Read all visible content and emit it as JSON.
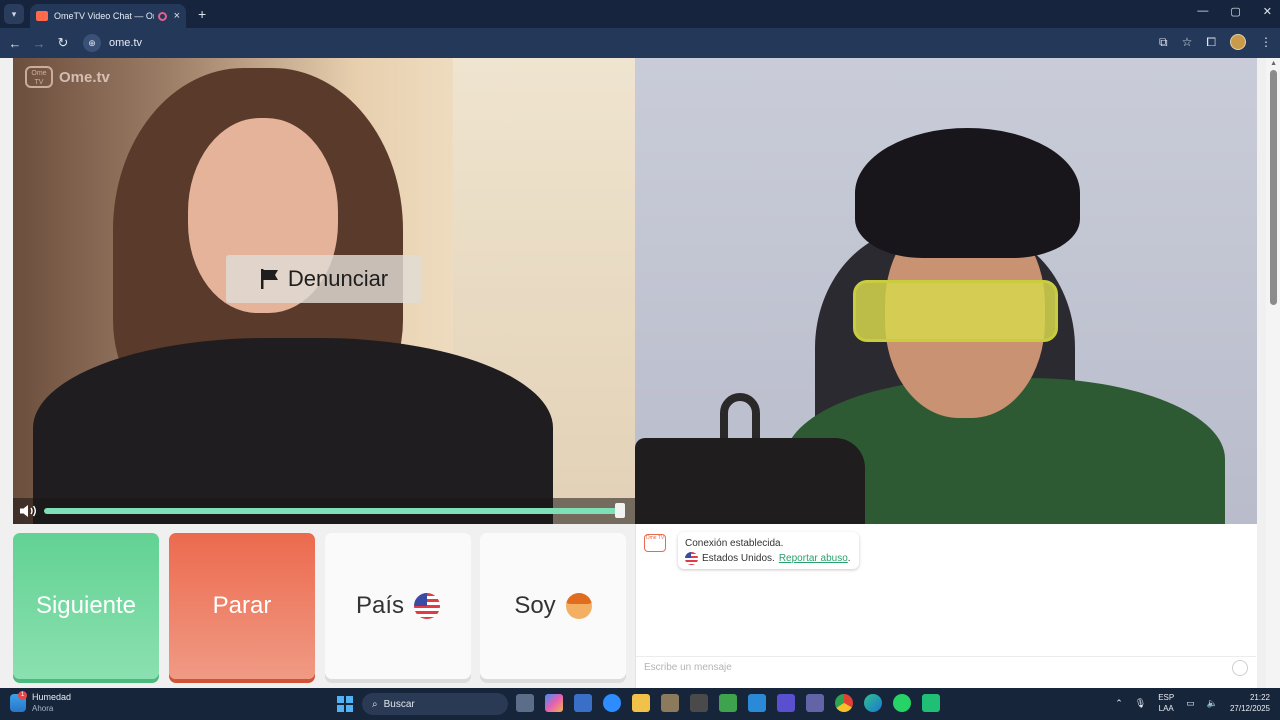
{
  "browser": {
    "tab_title": "OmeTV Video Chat — Ome",
    "tab_close": "×",
    "new_tab": "+",
    "url": "ome.tv",
    "window_controls": [
      "—",
      "▢",
      "✕"
    ]
  },
  "video_left": {
    "logo_text": "Ome.tv",
    "logo_mark": "Ome TV",
    "report_label": "Denunciar",
    "volume_level": 1.0
  },
  "buttons": {
    "next": "Siguiente",
    "stop": "Parar",
    "country": "País",
    "gender": "Soy"
  },
  "chat": {
    "logo_mark": "Ome TV",
    "connection_text": "Conexión establecida.",
    "country_text": "Estados Unidos.",
    "report_link": "Reportar abuso",
    "report_suffix": ".",
    "input_placeholder": "Escribe un mensaje"
  },
  "taskbar": {
    "weather_title": "Humedad",
    "weather_sub": "Ahora",
    "weather_badge": "1",
    "search_label": "Buscar",
    "lang_top": "ESP",
    "lang_bottom": "LAA",
    "time": "21:22",
    "date": "27/12/2025"
  },
  "colors": {
    "next": "#62d293",
    "stop": "#ec6a4e",
    "accent_link": "#2aa06d",
    "volume": "#7fe0b8"
  }
}
